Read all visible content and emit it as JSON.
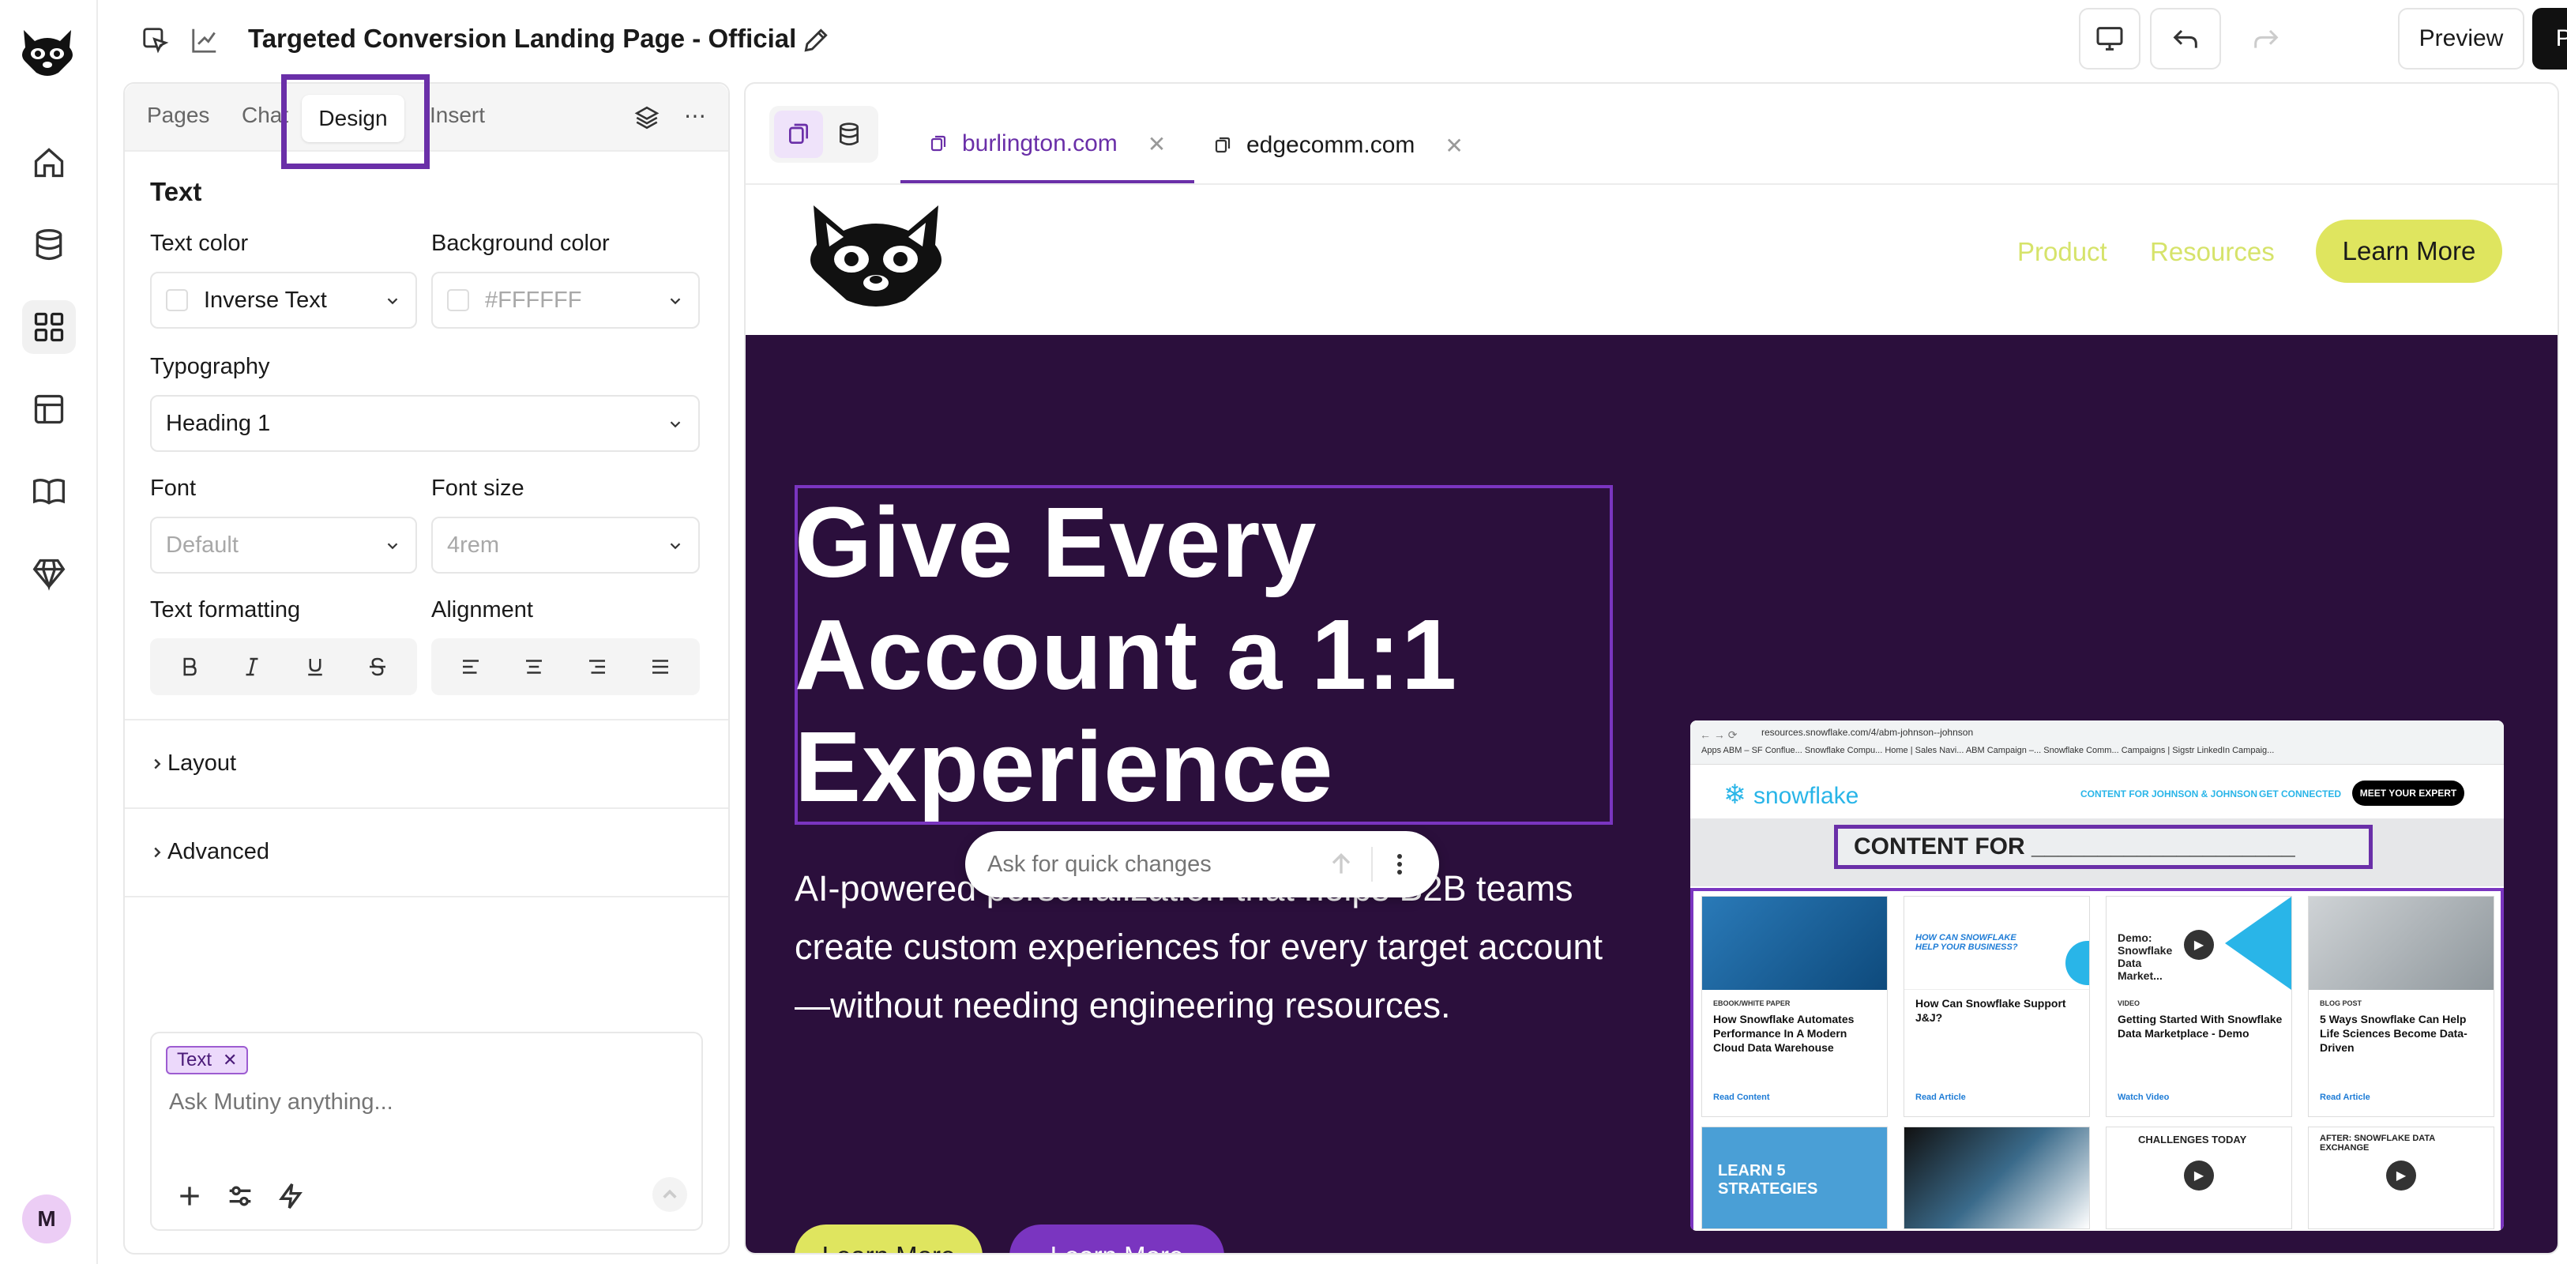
{
  "doc": {
    "title": "Targeted Conversion Landing Page - Official"
  },
  "topbar": {
    "preview": "Preview",
    "publish": "Publish"
  },
  "panel": {
    "tabs": [
      {
        "label": "Pages"
      },
      {
        "label": "Chat"
      },
      {
        "label": "Design"
      },
      {
        "label": "Insert"
      }
    ],
    "section_title": "Text",
    "text_color_label": "Text color",
    "text_color_value": "Inverse Text",
    "bg_color_label": "Background color",
    "bg_color_value": "#FFFFFF",
    "typography_label": "Typography",
    "typography_value": "Heading 1",
    "font_label": "Font",
    "font_value": "Default",
    "font_size_label": "Font size",
    "font_size_value": "4rem",
    "formatting_label": "Text formatting",
    "alignment_label": "Alignment",
    "layout_label": "Layout",
    "advanced_label": "Advanced",
    "chat": {
      "chip": "Text",
      "placeholder": "Ask Mutiny anything..."
    }
  },
  "canvas": {
    "tabs": [
      {
        "label": "burlington.com"
      },
      {
        "label": "edgecomm.com"
      }
    ]
  },
  "site": {
    "nav": [
      "Product",
      "Resources"
    ],
    "header_cta": "Learn More",
    "hero": {
      "title": "Give Every Account a 1:1 Experience",
      "subtitle": "AI-powered personalization that helps B2B teams create custom experiences for every target account—without needing engineering resources.",
      "quick_placeholder": "Ask for quick changes",
      "cta1": "Learn More",
      "cta2": "Learn More"
    },
    "shot": {
      "url": "resources.snowflake.com/4/abm-johnson--johnson",
      "bookmarks": "Apps   ABM – SF Conflue...   Snowflake Compu...   Home | Sales Navi...   ABM Campaign –...   Snowflake Comm...   Campaigns | Sigstr   LinkedIn Campaig...",
      "logo": "snowflake",
      "nav": [
        "CONTENT FOR JOHNSON & JOHNSON",
        "GET CONNECTED"
      ],
      "meet": "MEET YOUR EXPERT",
      "content_for": "CONTENT FOR ____________________",
      "cards": [
        {
          "kind": "EBOOK/WHITE PAPER",
          "title": "How Snowflake Automates Performance In A Modern Cloud Data Warehouse",
          "link": "Read Content"
        },
        {
          "kind": "",
          "title": "How Can Snowflake Support J&J?",
          "link": "Read Article"
        },
        {
          "kind": "VIDEO",
          "title": "Getting Started With Snowflake Data Marketplace - Demo",
          "link": "Watch Video"
        },
        {
          "kind": "BLOG POST",
          "title": "5 Ways Snowflake Can Help Life Sciences Become Data-Driven",
          "link": "Read Article"
        }
      ],
      "card1_heading": "HOW CAN SNOWFLAKE HELP YOUR BUSINESS?",
      "card2_heading": "Demo: Snowflake Data Market...",
      "learn5": "LEARN 5 STRATEGIES",
      "challenges": "CHALLENGES TODAY",
      "after": "AFTER: SNOWFLAKE DATA EXCHANGE"
    }
  },
  "user": {
    "initial": "M"
  },
  "colors": {
    "accent": "#6a2fa8",
    "hero_bg": "#2b0f3c",
    "lime": "#dfe55f"
  }
}
